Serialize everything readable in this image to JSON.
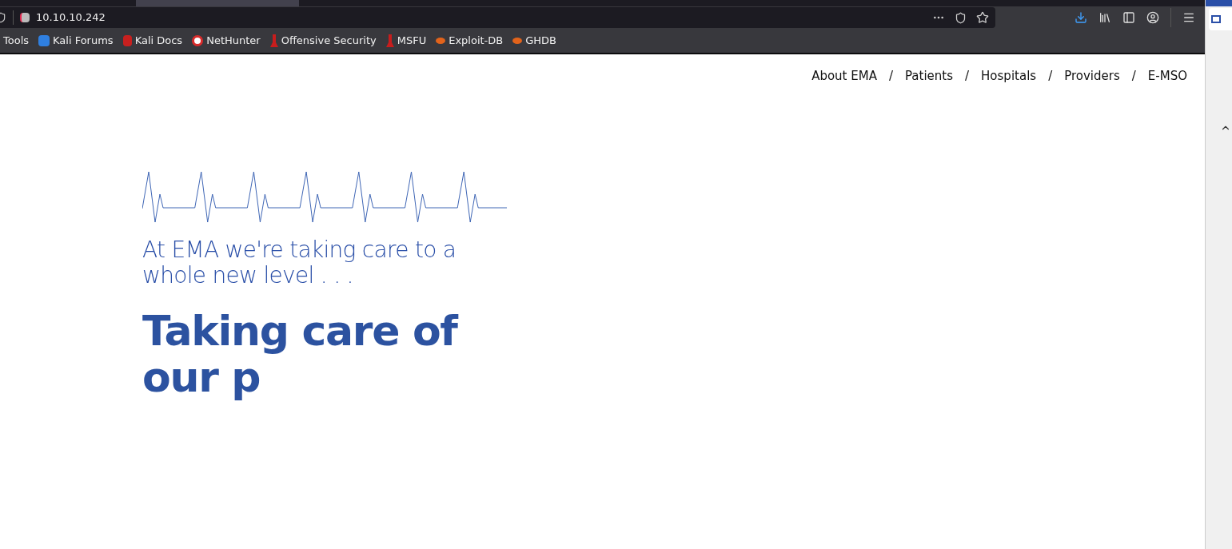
{
  "address_bar": {
    "url": "10.10.10.242"
  },
  "bookmarks": [
    {
      "label": "Tools",
      "kind": "none"
    },
    {
      "label": "Kali Forums",
      "kind": "forum"
    },
    {
      "label": "Kali Docs",
      "kind": "docs"
    },
    {
      "label": "NetHunter",
      "kind": "nethunter"
    },
    {
      "label": "Offensive Security",
      "kind": "offsec"
    },
    {
      "label": "MSFU",
      "kind": "offsec"
    },
    {
      "label": "Exploit-DB",
      "kind": "exploit"
    },
    {
      "label": "GHDB",
      "kind": "exploit"
    }
  ],
  "nav": {
    "items": [
      "About EMA",
      "Patients",
      "Hospitals",
      "Providers",
      "E-MSO"
    ],
    "separator": "/"
  },
  "hero": {
    "tagline": "At EMA we're taking care to a whole new level . . .",
    "headline": "Taking care of our p"
  }
}
